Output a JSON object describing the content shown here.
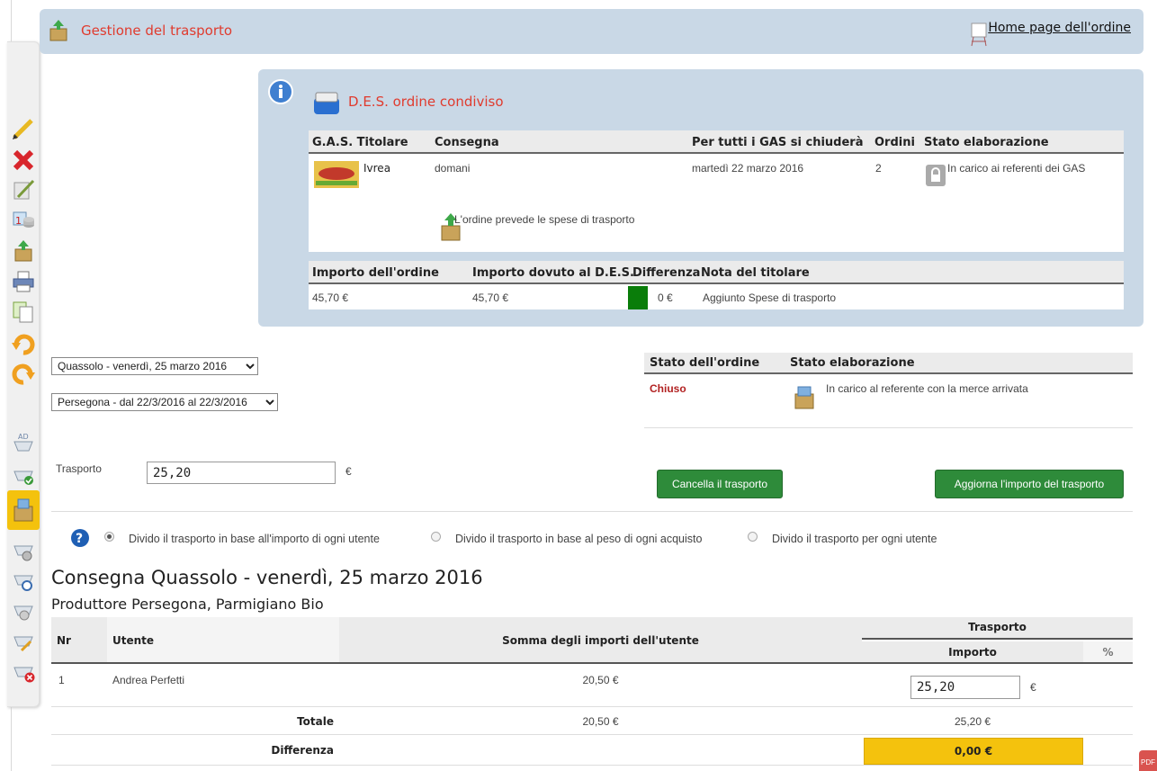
{
  "header": {
    "title": "Gestione del trasporto",
    "home_link": "Home page dell'ordine"
  },
  "rail": {
    "icons": [
      "edit-pencil-icon",
      "delete-x-icon",
      "edit-note-icon",
      "calendar-db-icon",
      "transport-box-icon",
      "printer-icon",
      "copy-docs-icon",
      "undo-arrow-icon",
      "redo-arrow-icon",
      "cart-icon",
      "cart-check-icon",
      "cart-box-active-icon",
      "cart-gear-icon",
      "cart-clock-icon",
      "cart-settings-icon",
      "cart-wrench-icon",
      "cart-delete-icon"
    ]
  },
  "des": {
    "title": "D.E.S. ordine condiviso",
    "table1": {
      "headers": [
        "G.A.S. Titolare",
        "Consegna",
        "Per tutti i GAS si chiuderà",
        "Ordini",
        "Stato elaborazione"
      ],
      "row": {
        "gas": "Ivrea",
        "consegna": "domani",
        "chiusura": "martedì 22 marzo 2016",
        "ordini": "2",
        "stato": "In carico ai referenti dei GAS"
      },
      "note": "L'ordine prevede le spese di trasporto"
    },
    "table2": {
      "headers": [
        "Importo dell'ordine",
        "Importo dovuto al D.E.S.",
        "Differenza",
        "Nota del titolare"
      ],
      "row": {
        "importo": "45,70 €",
        "dovuto": "45,70 €",
        "differenza": "0 €",
        "nota": "Aggiunto Spese di trasporto"
      },
      "diff_color": "#0a7d0a"
    }
  },
  "filters": {
    "consegna": "Quassolo - venerdì, 25 marzo 2016",
    "produttore": "Persegona - dal 22/3/2016 al 22/3/2016"
  },
  "order_state": {
    "headers": [
      "Stato dell'ordine",
      "Stato elaborazione"
    ],
    "stato": "Chiuso",
    "elaborazione": "In carico al referente con la merce arrivata",
    "stato_color": "#b22222"
  },
  "transport": {
    "label": "Trasporto",
    "value": "25,20",
    "currency": "€"
  },
  "buttons": {
    "cancel": "Cancella il trasporto",
    "update": "Aggiorna l'importo del trasporto"
  },
  "split_options": [
    {
      "label": "Divido il trasporto in base all'importo di ogni utente",
      "selected": true
    },
    {
      "label": "Divido il trasporto in base al peso di ogni acquisto",
      "selected": false
    },
    {
      "label": "Divido il trasporto per ogni utente",
      "selected": false
    }
  ],
  "section": {
    "title": "Consegna Quassolo - venerdì, 25 marzo 2016",
    "subtitle": "Produttore Persegona, Parmigiano Bio"
  },
  "table": {
    "headers": {
      "nr": "Nr",
      "utente": "Utente",
      "somma": "Somma degli importi dell'utente",
      "trasporto": "Trasporto",
      "importo": "Importo",
      "percent": "%"
    },
    "rows": [
      {
        "nr": "1",
        "utente": "Andrea Perfetti",
        "somma": "20,50 €",
        "trasporto": "25,20",
        "currency": "€"
      }
    ],
    "totale": {
      "label": "Totale",
      "somma": "20,50 €",
      "trasporto": "25,20 €"
    },
    "differenza": {
      "label": "Differenza",
      "value": "0,00 €"
    }
  },
  "pdf_tag": "PDF"
}
